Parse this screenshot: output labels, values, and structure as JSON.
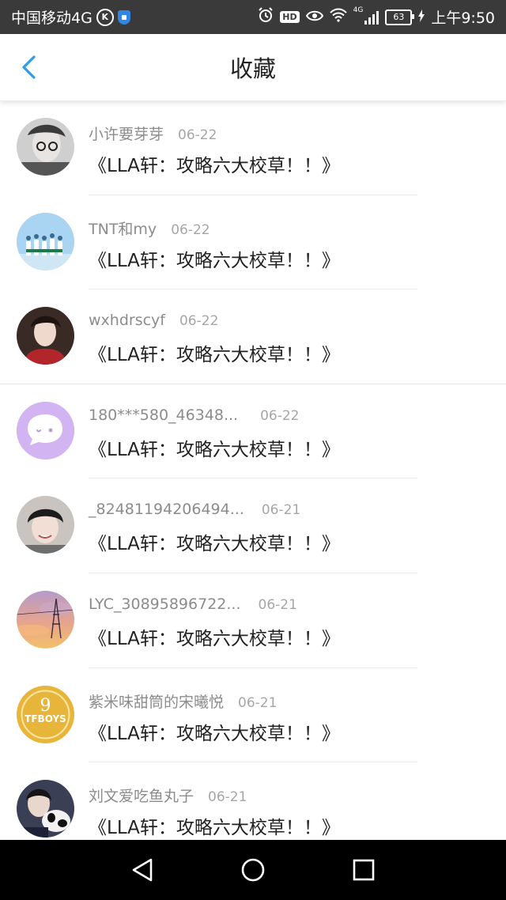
{
  "status_bar": {
    "carrier": "中国移动4G",
    "k_badge": "K",
    "hd": "HD",
    "net": "4G",
    "battery": "63",
    "time": "上午9:50"
  },
  "header": {
    "title": "收藏"
  },
  "items": [
    {
      "user": "小许要芽芽",
      "date": "06-22",
      "article": "《LLA轩：攻略六大校草！！》"
    },
    {
      "user": "TNT和my",
      "date": "06-22",
      "article": "《LLA轩：攻略六大校草！！》"
    },
    {
      "user": "wxhdrscyf",
      "date": "06-22",
      "article": "《LLA轩：攻略六大校草！！》"
    },
    {
      "user": "180***580_46348...",
      "date": "06-22",
      "article": "《LLA轩：攻略六大校草！！》"
    },
    {
      "user": "_82481194206494...",
      "date": "06-21",
      "article": "《LLA轩：攻略六大校草！！》"
    },
    {
      "user": "LYC_30895896722...",
      "date": "06-21",
      "article": "《LLA轩：攻略六大校草！！》"
    },
    {
      "user": "紫米味甜筒的宋曦悦",
      "date": "06-21",
      "article": "《LLA轩：攻略六大校草！！》"
    },
    {
      "user": "刘文爱吃鱼丸子",
      "date": "06-21",
      "article": "《LLA轩：攻略六大校草！！》"
    }
  ],
  "avatars": {
    "avatar_4_icon": "chat-bubble-icon",
    "avatar_7_text_top": "9",
    "avatar_7_text": "TFBOYS"
  },
  "colors": {
    "accent": "#2f9bea",
    "status_bar": "#3a3a3a",
    "chat_avatar_bg": "#d2b4f2",
    "tfboys_gold": "#e7b53a"
  }
}
